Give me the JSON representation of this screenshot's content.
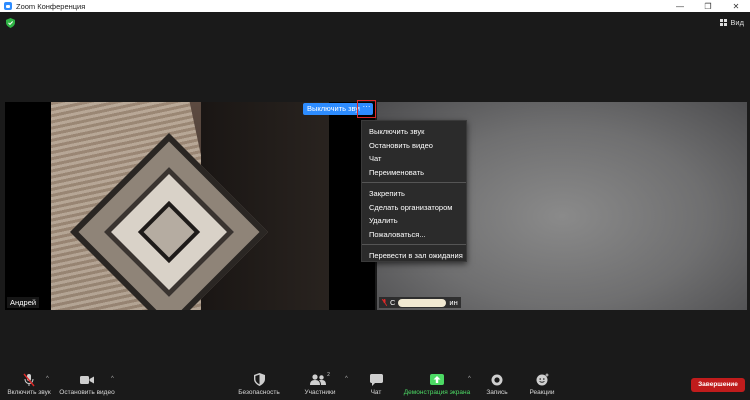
{
  "window": {
    "title": "Zoom Конференция",
    "minimize_glyph": "—",
    "restore_glyph": "❐",
    "close_glyph": "✕"
  },
  "top": {
    "view_label": "Вид"
  },
  "participants": [
    {
      "name": "Андрей"
    },
    {
      "name_prefix": "С",
      "name_suffix": "ин"
    }
  ],
  "hover_controls": {
    "mute_label": "Выключить звук",
    "more_label": "···"
  },
  "context_menu": {
    "group1": [
      "Выключить звук",
      "Остановить видео",
      "Чат",
      "Переименовать"
    ],
    "group2": [
      "Закрепить",
      "Сделать организатором",
      "Удалить",
      "Пожаловаться..."
    ],
    "group3": [
      "Перевести в зал ожидания"
    ]
  },
  "toolbar": {
    "mute_label": "Включить звук",
    "video_label": "Остановить видео",
    "security_label": "Безопасность",
    "participants_label": "Участники",
    "participants_count": "2",
    "chat_label": "Чат",
    "share_label": "Демонстрация экрана",
    "record_label": "Запись",
    "reactions_label": "Реакции",
    "end_label": "Завершение",
    "caret": "^"
  },
  "colors": {
    "accent_blue": "#2d8cff",
    "share_green": "#4cd964",
    "end_red": "#c01c1c",
    "highlight_red": "#e02828"
  }
}
